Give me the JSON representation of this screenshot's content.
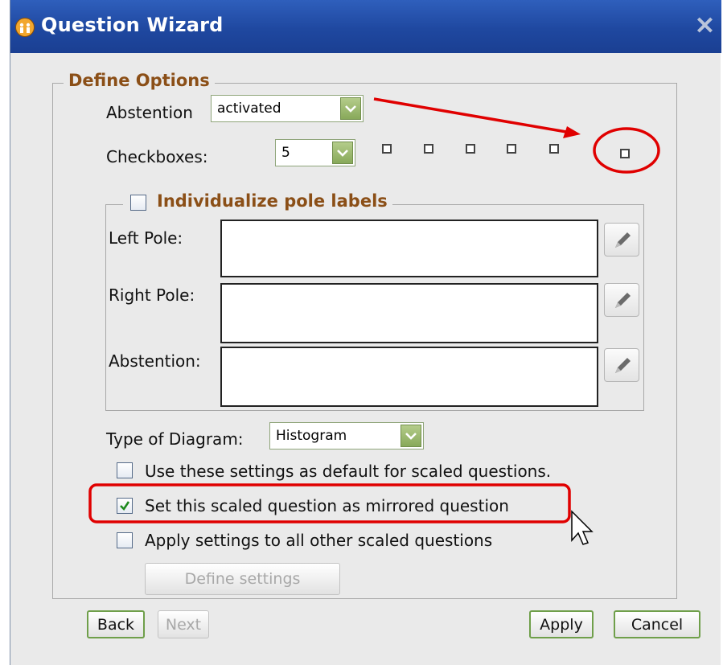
{
  "window": {
    "title": "Question Wizard",
    "close_icon": "close-icon"
  },
  "define_options": {
    "legend": "Define Options",
    "abstention": {
      "label": "Abstention",
      "value": "activated"
    },
    "checkboxes": {
      "label": "Checkboxes:",
      "value": "5"
    },
    "pole_labels": {
      "legend": "Individualize pole labels",
      "checked": false,
      "left_pole": {
        "label": "Left Pole:",
        "value": ""
      },
      "right_pole": {
        "label": "Right Pole:",
        "value": ""
      },
      "abstention": {
        "label": "Abstention:",
        "value": ""
      }
    },
    "diagram": {
      "label": "Type of Diagram:",
      "value": "Histogram"
    },
    "options": [
      {
        "label": "Use these settings as default for scaled questions.",
        "checked": false
      },
      {
        "label": "Set this scaled question as mirrored question",
        "checked": true
      },
      {
        "label": "Apply settings to all other scaled questions",
        "checked": false
      }
    ],
    "define_settings": "Define settings"
  },
  "footer": {
    "back": "Back",
    "next": "Next",
    "apply": "Apply",
    "cancel": "Cancel"
  },
  "colors": {
    "annotation": "#e00000",
    "legend": "#8b4f17",
    "titlebar": "#1f48a0"
  }
}
